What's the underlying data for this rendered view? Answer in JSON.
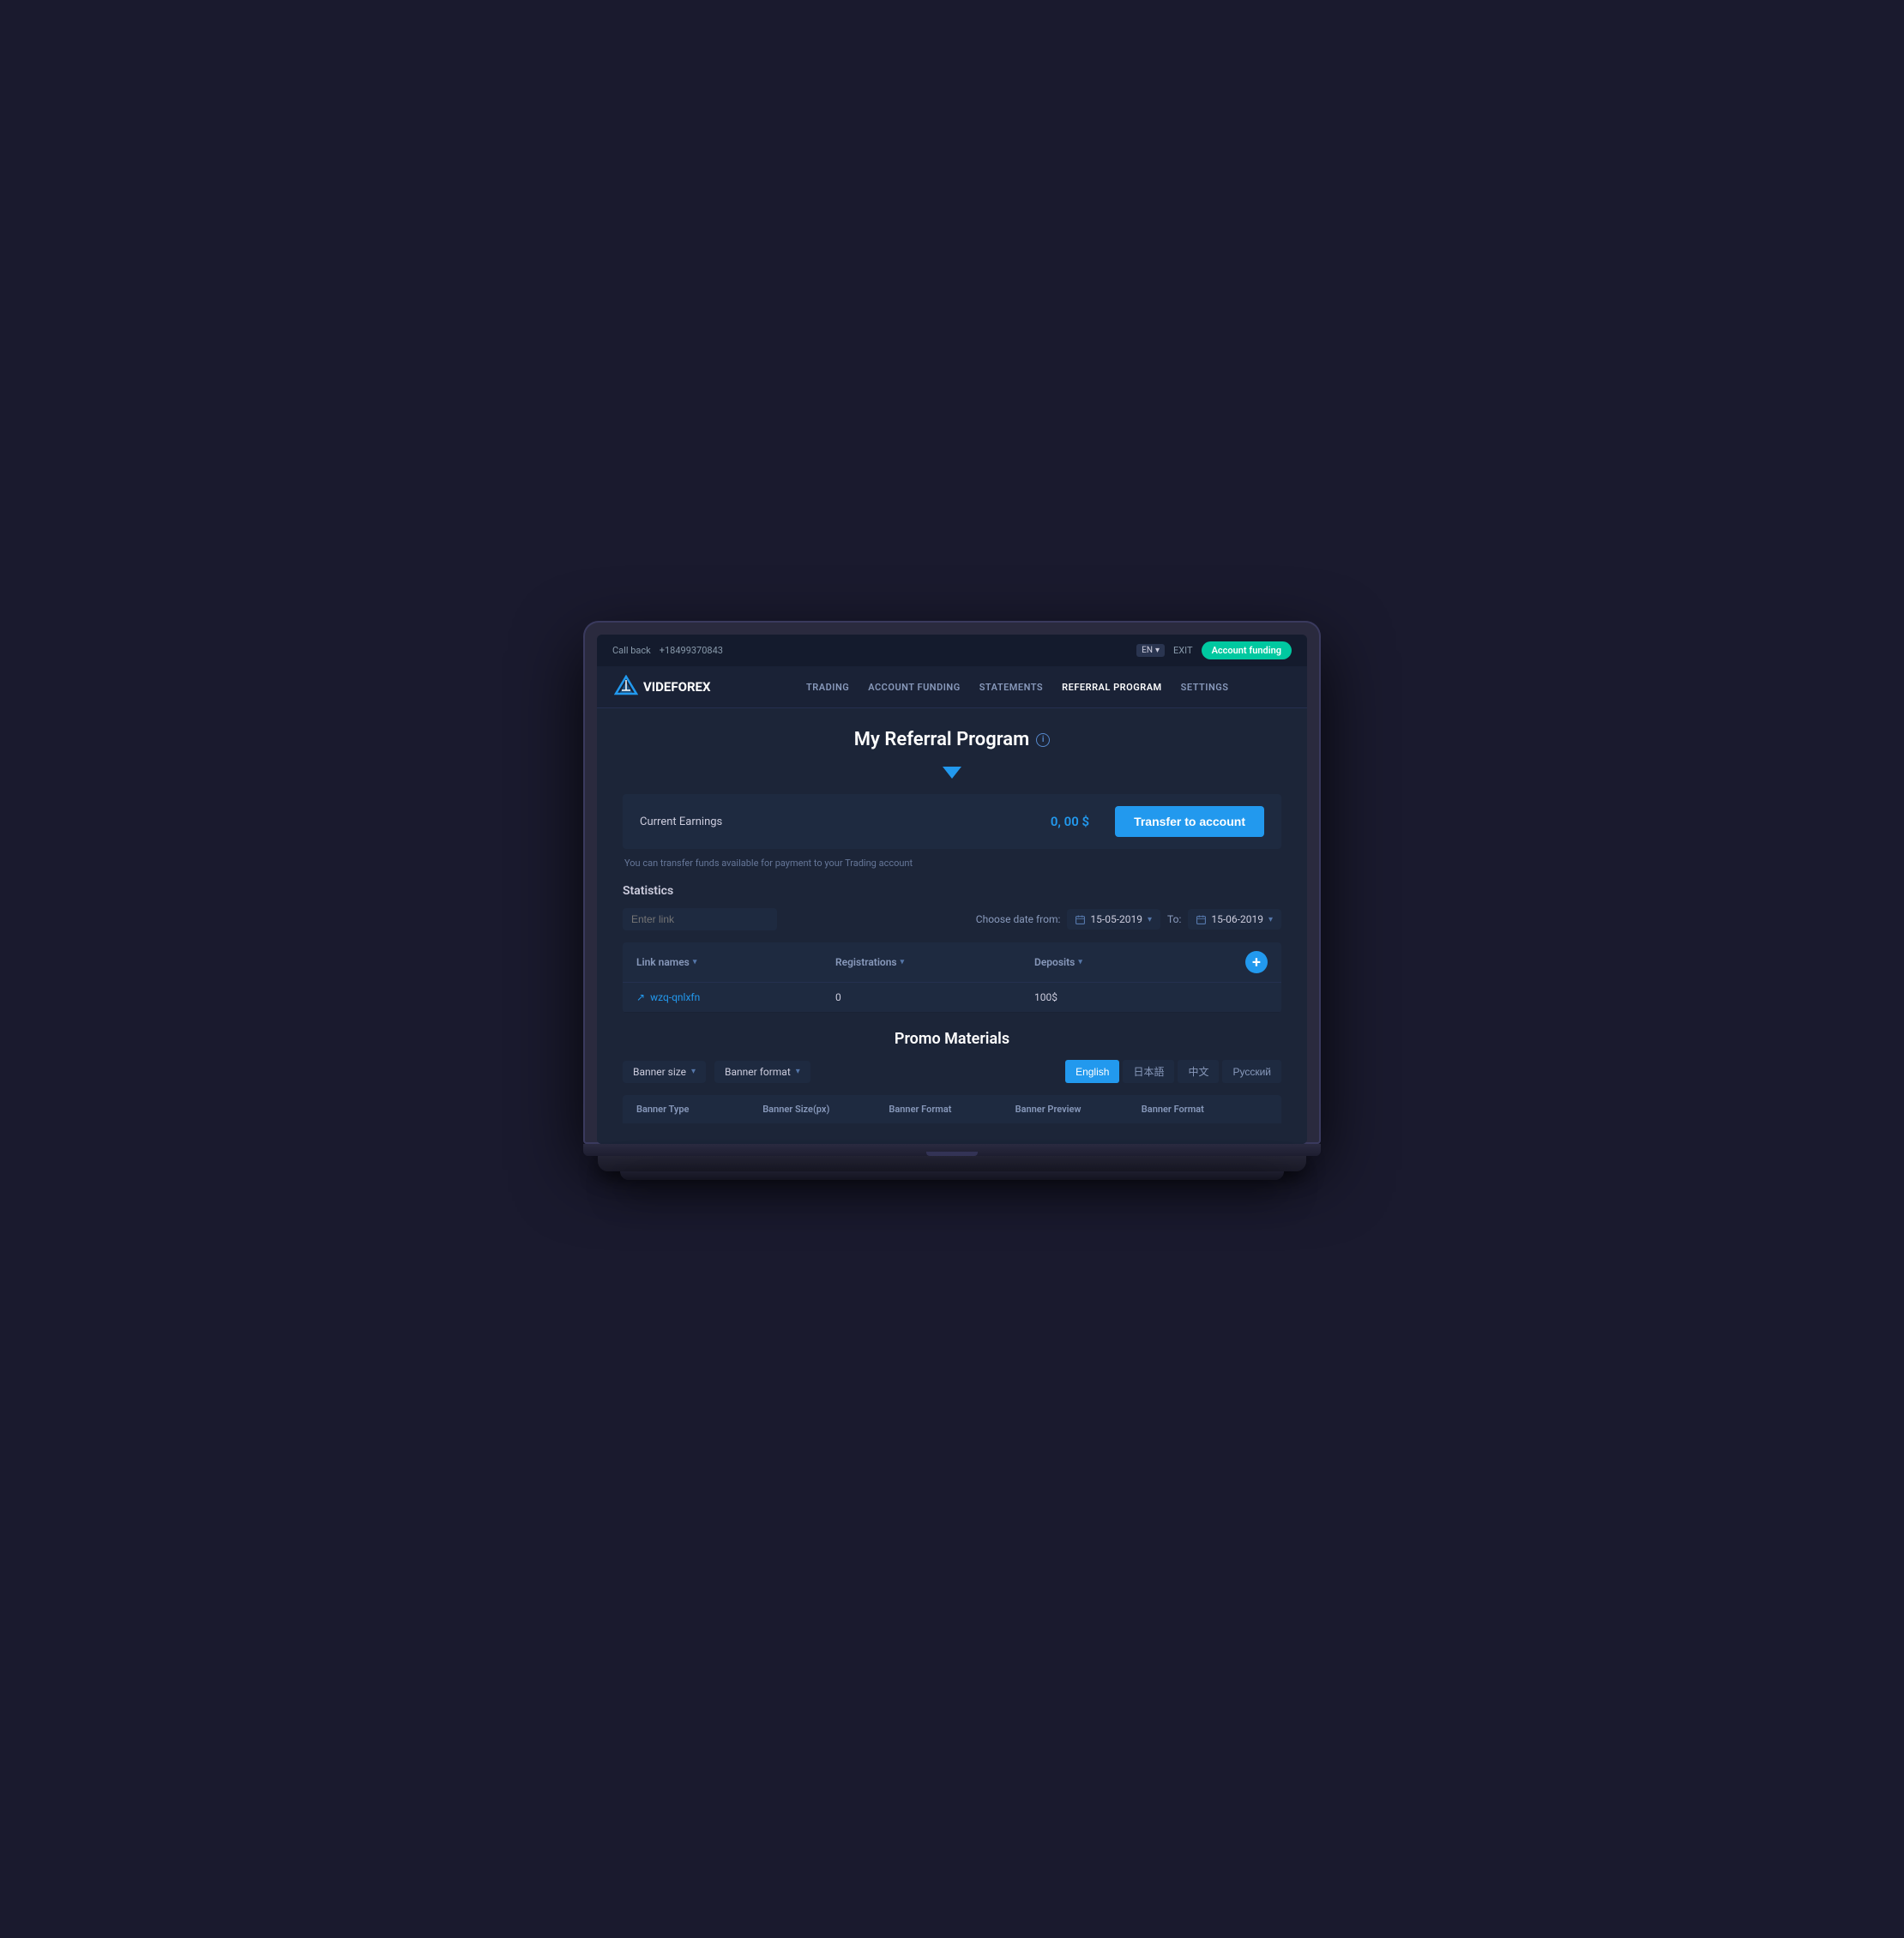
{
  "topbar": {
    "callback_label": "Call back",
    "phone": "+18499370843",
    "lang": "EN",
    "exit_label": "EXIT",
    "account_funding_btn": "Account funding"
  },
  "navbar": {
    "logo_text": "VIDEFOREX",
    "links": [
      {
        "label": "TRADING",
        "active": false
      },
      {
        "label": "ACCOUNT FUNDING",
        "active": false
      },
      {
        "label": "STATEMENTS",
        "active": false
      },
      {
        "label": "REFERRAL PROGRAM",
        "active": true
      },
      {
        "label": "SETTINGS",
        "active": false
      }
    ]
  },
  "page": {
    "title": "My Referral Program",
    "chevron_symbol": "▼",
    "earnings": {
      "label": "Current Earnings",
      "value": "0, 00 $",
      "transfer_btn": "Transfer to account",
      "note": "You can transfer funds available for payment to your Trading account"
    },
    "statistics": {
      "title": "Statistics",
      "search_placeholder": "Enter link",
      "date_from_label": "Choose date from:",
      "date_from": "15-05-2019",
      "date_to_label": "To:",
      "date_to": "15-06-2019",
      "columns": [
        "Link names",
        "Registrations",
        "Deposits"
      ],
      "rows": [
        {
          "link": "wzq-qnlxfn",
          "registrations": "0",
          "deposits": "100$"
        }
      ]
    },
    "promo": {
      "title": "Promo Materials",
      "dropdowns": [
        "Banner size",
        "Banner format"
      ],
      "languages": [
        "English",
        "日本語",
        "中文",
        "Русский"
      ],
      "active_lang": "English",
      "banner_columns": [
        "Banner Type",
        "Banner Size(px)",
        "Banner Format",
        "Banner Preview",
        "Banner Format"
      ]
    }
  }
}
